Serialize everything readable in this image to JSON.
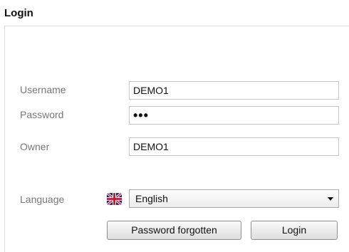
{
  "header": {
    "title": "Login"
  },
  "form": {
    "username": {
      "label": "Username",
      "value": "DEMO1"
    },
    "password": {
      "label": "Password",
      "value": "•••"
    },
    "owner": {
      "label": "Owner",
      "value": "DEMO1"
    },
    "language": {
      "label": "Language",
      "selected": "English",
      "flag_icon": "uk-flag-icon",
      "arrow_icon": "chevron-down-icon"
    }
  },
  "buttons": {
    "password_forgotten": "Password forgotten",
    "login": "Login"
  },
  "colors": {
    "label_text": "#777777",
    "field_border": "#c6c6c6",
    "flag_blue": "#012169",
    "flag_red": "#C8102E"
  }
}
